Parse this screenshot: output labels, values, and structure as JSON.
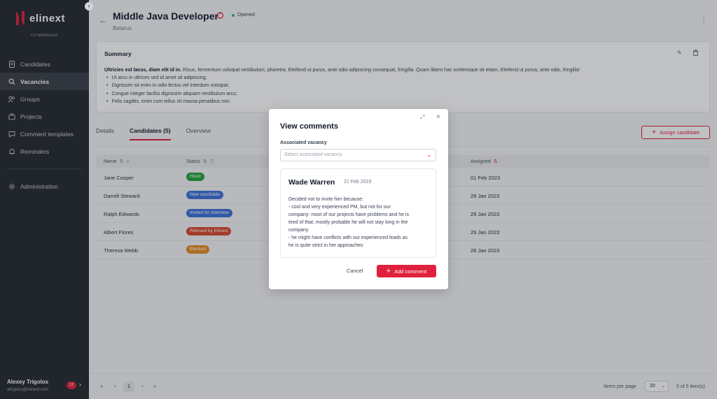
{
  "app": {
    "logo_text": "elinext",
    "logo_subtitle": "CV-MANAGER",
    "collapse_icon": "chevron-left-icon"
  },
  "sidebar": {
    "items": [
      {
        "label": "Candidates",
        "icon": "document-icon",
        "active": false
      },
      {
        "label": "Vacancies",
        "icon": "search-icon",
        "active": true
      },
      {
        "label": "Groups",
        "icon": "users-icon",
        "active": false
      },
      {
        "label": "Projects",
        "icon": "briefcase-icon",
        "active": false
      },
      {
        "label": "Comment templates",
        "icon": "comment-icon",
        "active": false
      },
      {
        "label": "Reminders",
        "icon": "bell-icon",
        "active": false
      }
    ],
    "admin": {
      "label": "Administration",
      "icon": "gear-icon"
    },
    "user": {
      "name": "Alexey Trigolos",
      "email": "atrigolos@elinext.com",
      "badge": "12"
    }
  },
  "header": {
    "title": "Middle Java Developer",
    "status": "Opened",
    "subtitle": "Belarus"
  },
  "summary": {
    "title": "Summary",
    "lead_bold": "Ultricies est lacus, diam elit id in.",
    "lead_rest": " Risus, fermentum volutpat vestibulum, pharetra. Eleifend ut purus, ante odio adipiscing consequat, fringilla. Quam libero hac scelerisque sit etiam, Eleifend ut purus, ante odio, fringilla!",
    "bullets": [
      "Ut arcu in ultrices sed id amet sit adipiscing;",
      "Dignissim sit enim in odio lectus vel interdum volutpat;",
      "Congue integer facilisi dignissim aliquam vestibulum arcu;",
      "Felis sagittis, enim cum tellus sit massa penatibus non."
    ]
  },
  "tabs": [
    {
      "label": "Details",
      "active": false
    },
    {
      "label": "Candidates (5)",
      "active": true
    },
    {
      "label": "Overview",
      "active": false
    }
  ],
  "assign_button": "Assign candidate",
  "table": {
    "columns": {
      "name": "Name",
      "status": "Status",
      "assigned": "Assigned"
    },
    "rows": [
      {
        "name": "Jane Cooper",
        "status": "Hired",
        "status_color": "#22a33a",
        "assigned": "01 Feb 2023"
      },
      {
        "name": "Darrell Steward",
        "status": "New candidate",
        "status_color": "#3b6fd8",
        "assigned": "29 Jan 2023"
      },
      {
        "name": "Ralph Edwards",
        "status": "Invited for interview",
        "status_color": "#3b6fd8",
        "assigned": "29 Jan 2023"
      },
      {
        "name": "Albert Flores",
        "status": "Refused by Elinext",
        "status_color": "#d9452f",
        "assigned": "29 Jan 2023"
      },
      {
        "name": "Theresa Webb",
        "status": "Blocked",
        "status_color": "#e58a1f",
        "assigned": "28 Jan 2023"
      }
    ]
  },
  "pagination": {
    "current_page": "1",
    "items_per_page_label": "Items per page",
    "items_per_page": "20",
    "items_count": "5 of 5 item(s)"
  },
  "modal": {
    "title": "View comments",
    "field_label": "Associated vacancy",
    "field_placeholder": "Select associated vacancy",
    "comment": {
      "author": "Wade Warren",
      "date": "21 Feb 2023",
      "lines": [
        "Decided not to invite him because:",
        "- cool and very experienced PM, but not for our",
        "company: most of our projects have problems and he is",
        "tired of that, mostly probable he will not stay long in the",
        "company",
        "- he might have conflicts with our experienced leads as",
        "he is quite strict in her approaches"
      ]
    },
    "cancel_label": "Cancel",
    "add_label": "Add comment"
  },
  "colors": {
    "accent": "#e0213d",
    "sidebar_bg": "#23272e"
  }
}
